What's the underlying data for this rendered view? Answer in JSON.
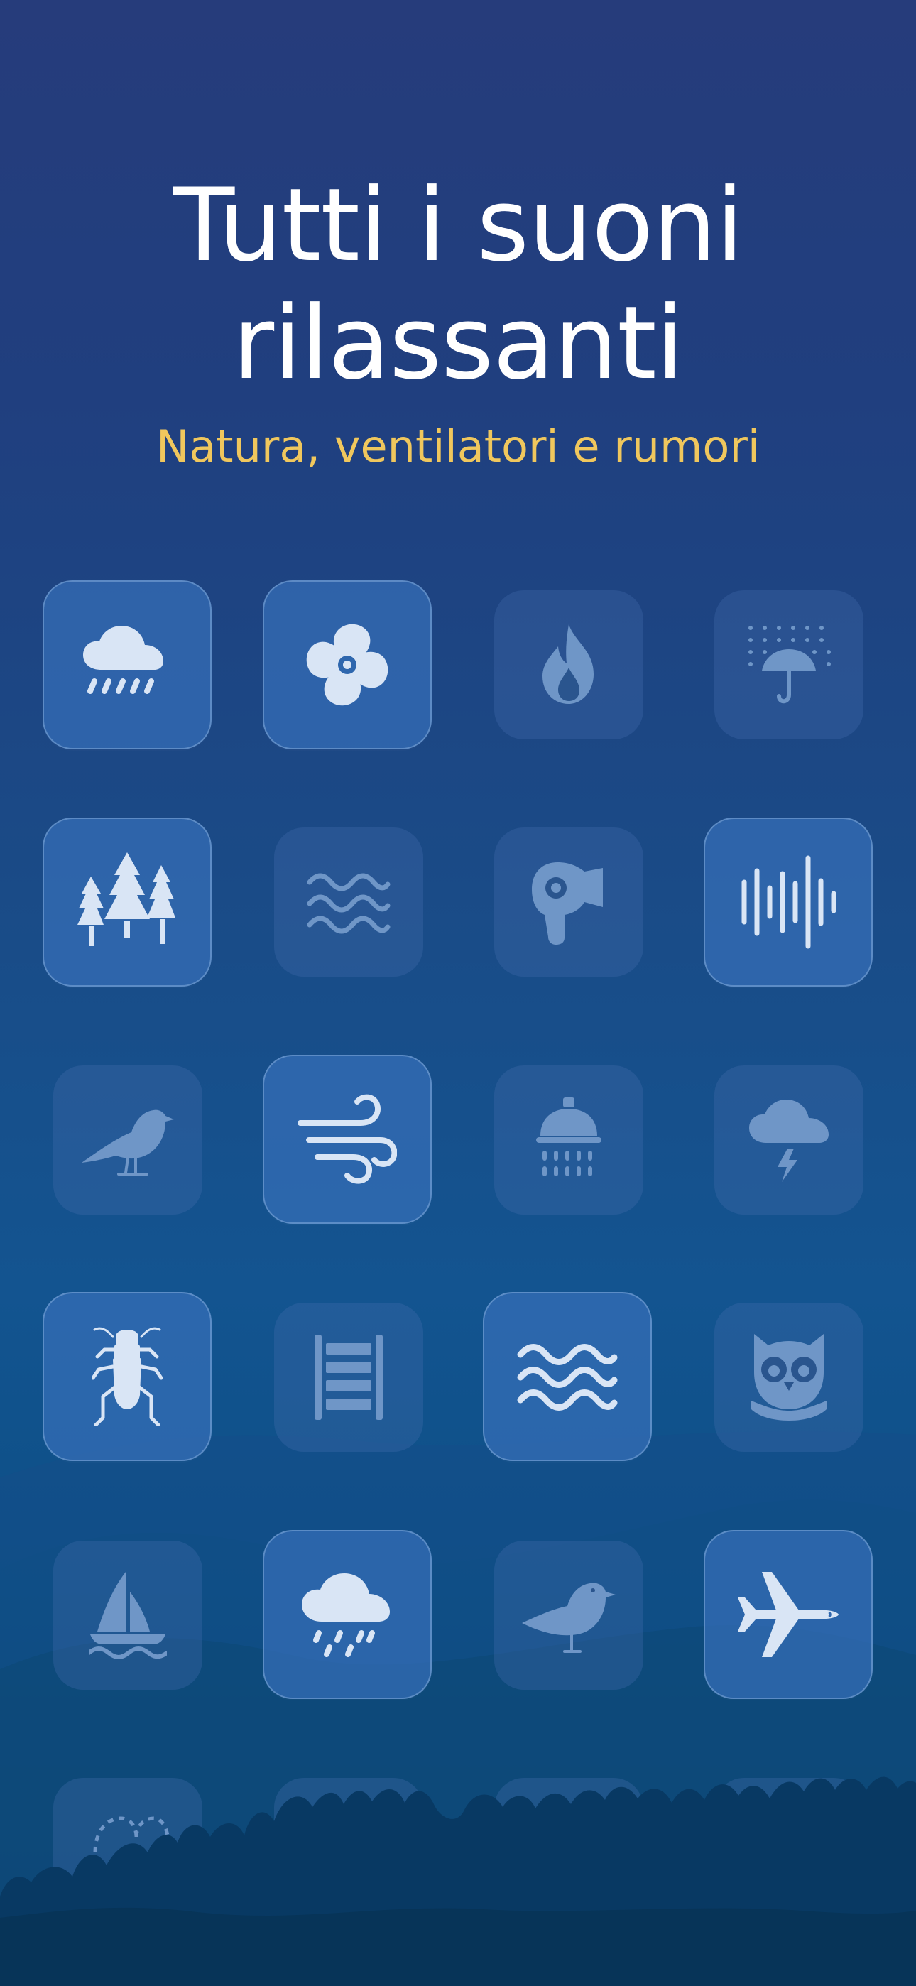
{
  "hero": {
    "title_line1": "Tutti i suoni",
    "title_line2": "rilassanti",
    "subtitle": "Natura, ventilatori e rumori"
  },
  "colors": {
    "background_top": "#263c7b",
    "background_bottom": "#0a3e6c",
    "title": "#ffffff",
    "subtitle": "#f0c75d",
    "active_tile": "#366fb8",
    "inactive_tile": "#426cad"
  },
  "tiles": [
    {
      "name": "rain",
      "state": "active",
      "icon": "rain-cloud-icon"
    },
    {
      "name": "fan",
      "state": "active",
      "icon": "fan-icon"
    },
    {
      "name": "fire",
      "state": "inactive",
      "icon": "fire-icon"
    },
    {
      "name": "umbrella-rain",
      "state": "inactive",
      "icon": "umbrella-rain-icon"
    },
    {
      "name": "forest",
      "state": "active",
      "icon": "forest-icon"
    },
    {
      "name": "water",
      "state": "inactive",
      "icon": "water-waves-icon"
    },
    {
      "name": "hair-dryer",
      "state": "inactive",
      "icon": "hair-dryer-icon"
    },
    {
      "name": "noise",
      "state": "active",
      "icon": "sound-wave-icon"
    },
    {
      "name": "bird",
      "state": "inactive",
      "icon": "bird-icon"
    },
    {
      "name": "wind",
      "state": "active",
      "icon": "wind-icon"
    },
    {
      "name": "shower",
      "state": "inactive",
      "icon": "shower-icon"
    },
    {
      "name": "thunderstorm",
      "state": "inactive",
      "icon": "thunderstorm-icon"
    },
    {
      "name": "cricket",
      "state": "active",
      "icon": "cricket-icon"
    },
    {
      "name": "train",
      "state": "inactive",
      "icon": "railway-icon"
    },
    {
      "name": "ocean",
      "state": "active",
      "icon": "ocean-waves-icon"
    },
    {
      "name": "owl",
      "state": "inactive",
      "icon": "owl-icon"
    },
    {
      "name": "sailboat",
      "state": "inactive",
      "icon": "sailboat-icon"
    },
    {
      "name": "light-rain",
      "state": "active",
      "icon": "light-rain-cloud-icon"
    },
    {
      "name": "seagull",
      "state": "inactive",
      "icon": "seagull-icon"
    },
    {
      "name": "airplane",
      "state": "active",
      "icon": "airplane-icon"
    }
  ]
}
